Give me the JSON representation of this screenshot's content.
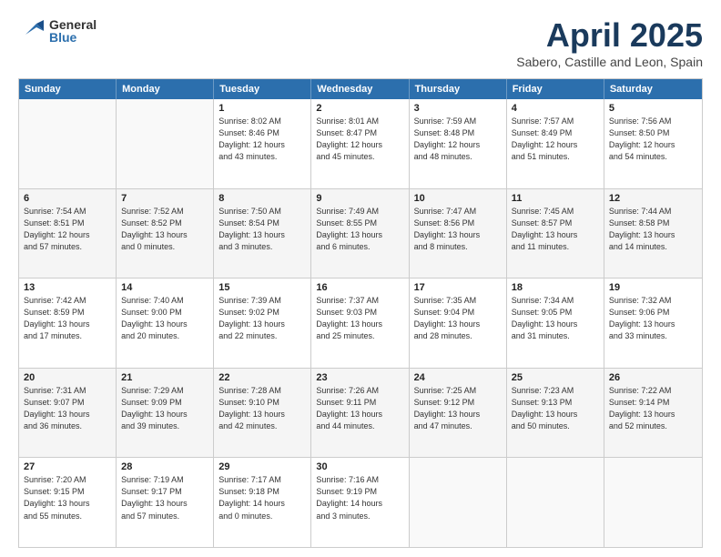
{
  "header": {
    "logo_general": "General",
    "logo_blue": "Blue",
    "month": "April 2025",
    "location": "Sabero, Castille and Leon, Spain"
  },
  "days_of_week": [
    "Sunday",
    "Monday",
    "Tuesday",
    "Wednesday",
    "Thursday",
    "Friday",
    "Saturday"
  ],
  "rows": [
    [
      {
        "day": "",
        "lines": [],
        "empty": true
      },
      {
        "day": "",
        "lines": [],
        "empty": true
      },
      {
        "day": "1",
        "lines": [
          "Sunrise: 8:02 AM",
          "Sunset: 8:46 PM",
          "Daylight: 12 hours",
          "and 43 minutes."
        ]
      },
      {
        "day": "2",
        "lines": [
          "Sunrise: 8:01 AM",
          "Sunset: 8:47 PM",
          "Daylight: 12 hours",
          "and 45 minutes."
        ]
      },
      {
        "day": "3",
        "lines": [
          "Sunrise: 7:59 AM",
          "Sunset: 8:48 PM",
          "Daylight: 12 hours",
          "and 48 minutes."
        ]
      },
      {
        "day": "4",
        "lines": [
          "Sunrise: 7:57 AM",
          "Sunset: 8:49 PM",
          "Daylight: 12 hours",
          "and 51 minutes."
        ]
      },
      {
        "day": "5",
        "lines": [
          "Sunrise: 7:56 AM",
          "Sunset: 8:50 PM",
          "Daylight: 12 hours",
          "and 54 minutes."
        ]
      }
    ],
    [
      {
        "day": "6",
        "lines": [
          "Sunrise: 7:54 AM",
          "Sunset: 8:51 PM",
          "Daylight: 12 hours",
          "and 57 minutes."
        ]
      },
      {
        "day": "7",
        "lines": [
          "Sunrise: 7:52 AM",
          "Sunset: 8:52 PM",
          "Daylight: 13 hours",
          "and 0 minutes."
        ]
      },
      {
        "day": "8",
        "lines": [
          "Sunrise: 7:50 AM",
          "Sunset: 8:54 PM",
          "Daylight: 13 hours",
          "and 3 minutes."
        ]
      },
      {
        "day": "9",
        "lines": [
          "Sunrise: 7:49 AM",
          "Sunset: 8:55 PM",
          "Daylight: 13 hours",
          "and 6 minutes."
        ]
      },
      {
        "day": "10",
        "lines": [
          "Sunrise: 7:47 AM",
          "Sunset: 8:56 PM",
          "Daylight: 13 hours",
          "and 8 minutes."
        ]
      },
      {
        "day": "11",
        "lines": [
          "Sunrise: 7:45 AM",
          "Sunset: 8:57 PM",
          "Daylight: 13 hours",
          "and 11 minutes."
        ]
      },
      {
        "day": "12",
        "lines": [
          "Sunrise: 7:44 AM",
          "Sunset: 8:58 PM",
          "Daylight: 13 hours",
          "and 14 minutes."
        ]
      }
    ],
    [
      {
        "day": "13",
        "lines": [
          "Sunrise: 7:42 AM",
          "Sunset: 8:59 PM",
          "Daylight: 13 hours",
          "and 17 minutes."
        ]
      },
      {
        "day": "14",
        "lines": [
          "Sunrise: 7:40 AM",
          "Sunset: 9:00 PM",
          "Daylight: 13 hours",
          "and 20 minutes."
        ]
      },
      {
        "day": "15",
        "lines": [
          "Sunrise: 7:39 AM",
          "Sunset: 9:02 PM",
          "Daylight: 13 hours",
          "and 22 minutes."
        ]
      },
      {
        "day": "16",
        "lines": [
          "Sunrise: 7:37 AM",
          "Sunset: 9:03 PM",
          "Daylight: 13 hours",
          "and 25 minutes."
        ]
      },
      {
        "day": "17",
        "lines": [
          "Sunrise: 7:35 AM",
          "Sunset: 9:04 PM",
          "Daylight: 13 hours",
          "and 28 minutes."
        ]
      },
      {
        "day": "18",
        "lines": [
          "Sunrise: 7:34 AM",
          "Sunset: 9:05 PM",
          "Daylight: 13 hours",
          "and 31 minutes."
        ]
      },
      {
        "day": "19",
        "lines": [
          "Sunrise: 7:32 AM",
          "Sunset: 9:06 PM",
          "Daylight: 13 hours",
          "and 33 minutes."
        ]
      }
    ],
    [
      {
        "day": "20",
        "lines": [
          "Sunrise: 7:31 AM",
          "Sunset: 9:07 PM",
          "Daylight: 13 hours",
          "and 36 minutes."
        ]
      },
      {
        "day": "21",
        "lines": [
          "Sunrise: 7:29 AM",
          "Sunset: 9:09 PM",
          "Daylight: 13 hours",
          "and 39 minutes."
        ]
      },
      {
        "day": "22",
        "lines": [
          "Sunrise: 7:28 AM",
          "Sunset: 9:10 PM",
          "Daylight: 13 hours",
          "and 42 minutes."
        ]
      },
      {
        "day": "23",
        "lines": [
          "Sunrise: 7:26 AM",
          "Sunset: 9:11 PM",
          "Daylight: 13 hours",
          "and 44 minutes."
        ]
      },
      {
        "day": "24",
        "lines": [
          "Sunrise: 7:25 AM",
          "Sunset: 9:12 PM",
          "Daylight: 13 hours",
          "and 47 minutes."
        ]
      },
      {
        "day": "25",
        "lines": [
          "Sunrise: 7:23 AM",
          "Sunset: 9:13 PM",
          "Daylight: 13 hours",
          "and 50 minutes."
        ]
      },
      {
        "day": "26",
        "lines": [
          "Sunrise: 7:22 AM",
          "Sunset: 9:14 PM",
          "Daylight: 13 hours",
          "and 52 minutes."
        ]
      }
    ],
    [
      {
        "day": "27",
        "lines": [
          "Sunrise: 7:20 AM",
          "Sunset: 9:15 PM",
          "Daylight: 13 hours",
          "and 55 minutes."
        ]
      },
      {
        "day": "28",
        "lines": [
          "Sunrise: 7:19 AM",
          "Sunset: 9:17 PM",
          "Daylight: 13 hours",
          "and 57 minutes."
        ]
      },
      {
        "day": "29",
        "lines": [
          "Sunrise: 7:17 AM",
          "Sunset: 9:18 PM",
          "Daylight: 14 hours",
          "and 0 minutes."
        ]
      },
      {
        "day": "30",
        "lines": [
          "Sunrise: 7:16 AM",
          "Sunset: 9:19 PM",
          "Daylight: 14 hours",
          "and 3 minutes."
        ]
      },
      {
        "day": "",
        "lines": [],
        "empty": true
      },
      {
        "day": "",
        "lines": [],
        "empty": true
      },
      {
        "day": "",
        "lines": [],
        "empty": true
      }
    ]
  ]
}
